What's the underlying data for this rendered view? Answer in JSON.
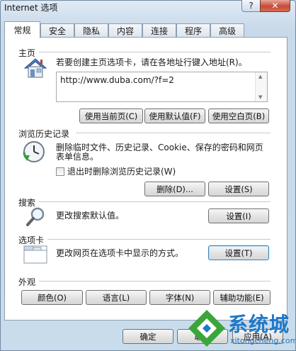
{
  "window": {
    "title": "Internet 选项",
    "help_label": "?",
    "close_label": "✕"
  },
  "tabs": [
    "常规",
    "安全",
    "隐私",
    "内容",
    "连接",
    "程序",
    "高级"
  ],
  "home": {
    "section_label": "主页",
    "description": "若要创建主页选项卡，请在各地址行键入地址(R)。",
    "url_value": "http://www.duba.com/?f=2",
    "buttons": [
      "使用当前页(C)",
      "使用默认值(F)",
      "使用空白页(B)"
    ]
  },
  "history": {
    "section_label": "浏览历史记录",
    "description_line1": "删除临时文件、历史记录、Cookie、保存的密码和网页",
    "description_line2": "表单信息。",
    "checkbox_label": "退出时删除浏览历史记录(W)",
    "checkbox_checked": false,
    "delete_button": "删除(D)...",
    "settings_button": "设置(S)"
  },
  "search": {
    "section_label": "搜索",
    "description": "更改搜索默认值。",
    "settings_button": "设置(I)"
  },
  "tabs_section": {
    "section_label": "选项卡",
    "description": "更改网页在选项卡中显示的方式。",
    "settings_button": "设置(T)"
  },
  "appearance": {
    "section_label": "外观",
    "buttons": [
      "颜色(O)",
      "语言(L)",
      "字体(N)",
      "辅助功能(E)"
    ]
  },
  "footer": {
    "ok_label": "确定",
    "cancel_label": "取消",
    "apply_label": "应用(A)"
  },
  "watermark": {
    "brand": "系统城",
    "domain": "xitongcheng.com"
  },
  "colors": {
    "accent": "#3c7fb1",
    "close_button": "#c74a37",
    "watermark_green": "#3aa63a",
    "watermark_blue": "#1f78c8"
  }
}
